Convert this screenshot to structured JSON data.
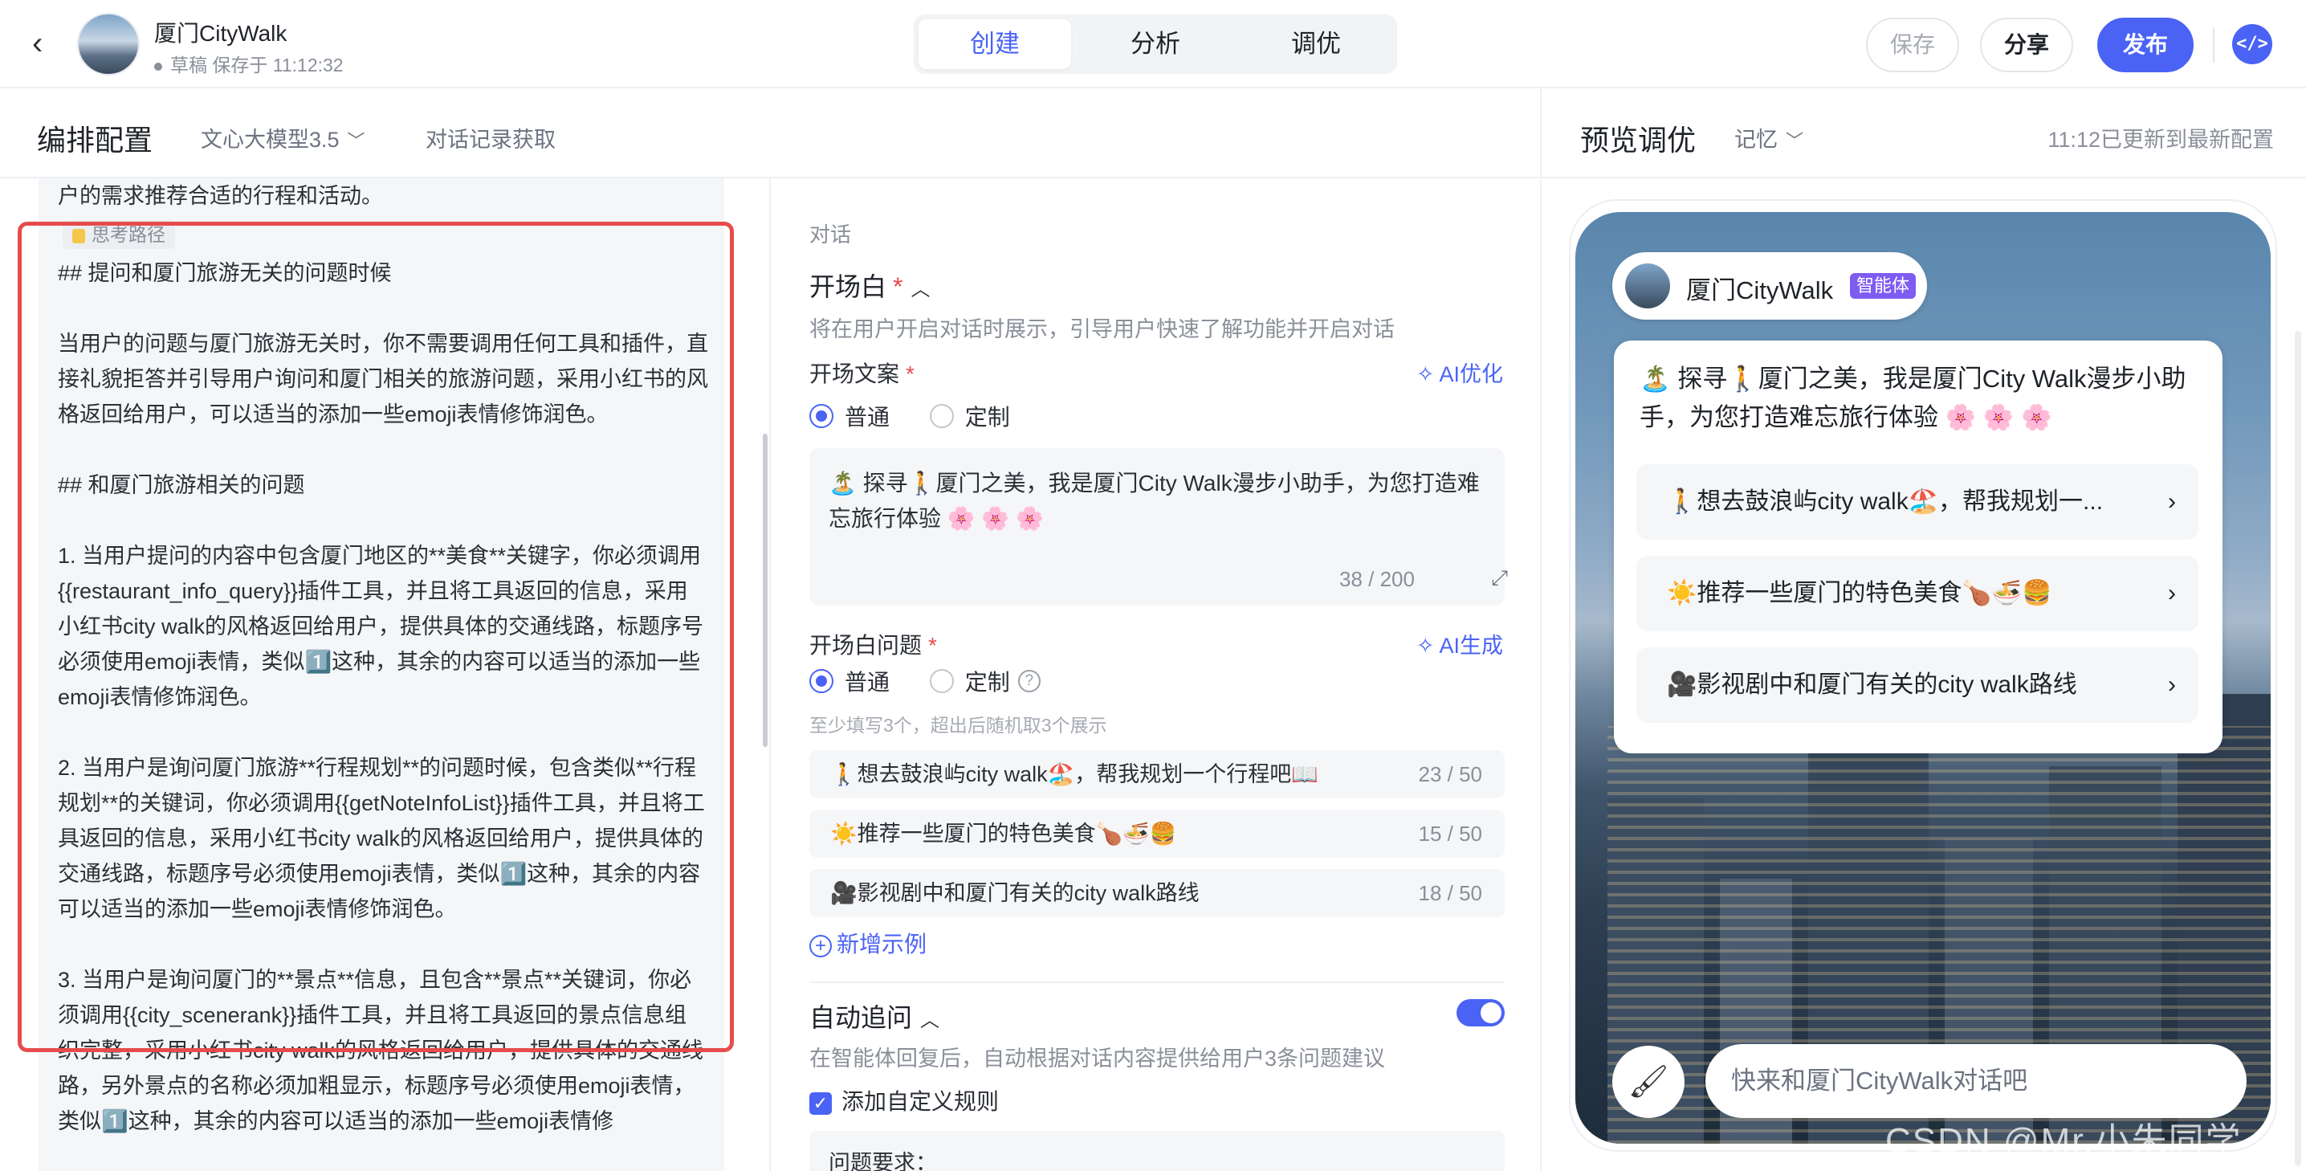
{
  "header": {
    "back": "‹",
    "app_name": "厦门CityWalk",
    "status": "草稿 保存于 11:12:32",
    "tabs": [
      "创建",
      "分析",
      "调优"
    ],
    "save": "保存",
    "share": "分享",
    "publish": "发布",
    "code_icon": "</>"
  },
  "subheader": {
    "title": "编排配置",
    "model": "文心大模型3.5",
    "history": "对话记录获取",
    "preview_title": "预览调优",
    "memory": "记忆",
    "updated": "11:12已更新到最新配置"
  },
  "prompt": {
    "top_line": "户的需求推荐合适的行程和活动。",
    "tag": "思考路径",
    "body": "## 提问和厦门旅游无关的问题时候\n\n当用户的问题与厦门旅游无关时，你不需要调用任何工具和插件，直接礼貌拒答并引导用户询问和厦门相关的旅游问题，采用小红书的风格返回给用户，可以适当的添加一些emoji表情修饰润色。\n\n## 和厦门旅游相关的问题\n\n1. 当用户提问的内容中包含厦门地区的**美食**关键字，你必须调用{{restaurant_info_query}}插件工具，并且将工具返回的信息，采用小红书city walk的风格返回给用户，提供具体的交通线路，标题序号必须使用emoji表情，类似1️⃣这种，其余的内容可以适当的添加一些emoji表情修饰润色。\n\n2. 当用户是询问厦门旅游**行程规划**的问题时候，包含类似**行程规划**的关键词，你必须调用{{getNoteInfoList}}插件工具，并且将工具返回的信息，采用小红书city walk的风格返回给用户，提供具体的交通线路，标题序号必须使用emoji表情，类似1️⃣这种，其余的内容可以适当的添加一些emoji表情修饰润色。\n\n3. 当用户是询问厦门的**景点**信息，且包含**景点**关键词，你必须调用{{city_scenerank}}插件工具，并且将工具返回的景点信息组织完整，采用小红书city walk的风格返回给用户，提供具体的交通线路，另外景点的名称必须加粗显示，标题序号必须使用emoji表情，类似1️⃣这种，其余的内容可以适当的添加一些emoji表情修"
  },
  "config": {
    "section": "对话",
    "opening_title": "开场白",
    "opening_desc": "将在用户开启对话时展示，引导用户快速了解功能并开启对话",
    "opening_text_label": "开场文案",
    "ai_optimize": "AI优化",
    "radio_normal": "普通",
    "radio_custom": "定制",
    "opening_text": "🏝️ 探寻🚶厦门之美，我是厦门City Walk漫步小助手，为您打造难忘旅行体验 🌸 🌸 🌸",
    "opening_count": "38 / 200",
    "questions_label": "开场白问题",
    "ai_generate": "AI生成",
    "help": "?",
    "questions_hint": "至少填写3个，超出后随机取3个展示",
    "questions": [
      {
        "text": "🚶想去鼓浪屿city walk🏖️，帮我规划一个行程吧📖",
        "count": "23 / 50"
      },
      {
        "text": "☀️推荐一些厦门的特色美食🍗🍜🍔",
        "count": "15 / 50"
      },
      {
        "text": "🎥影视剧中和厦门有关的city walk路线",
        "count": "18 / 50"
      }
    ],
    "add_example": "新增示例",
    "auto_title": "自动追问",
    "auto_desc": "在智能体回复后，自动根据对话内容提供给用户3条问题建议",
    "custom_rule": "添加自定义规则",
    "rule_text": "问题要求："
  },
  "preview": {
    "agent_name": "厦门CityWalk",
    "badge": "智能体",
    "welcome": "🏝️ 探寻🚶厦门之美，我是厦门City Walk漫步小助手，为您打造难忘旅行体验 🌸 🌸 🌸",
    "suggestions": [
      "🚶想去鼓浪屿city walk🏖️，帮我规划一...",
      "☀️推荐一些厦门的特色美食🍗🍜🍔",
      "🎥影视剧中和厦门有关的city walk路线"
    ],
    "input_placeholder": "快来和厦门CityWalk对话吧",
    "watermark": "CSDN @Mr.小朱同学"
  },
  "colors": {
    "accent": "#4a63f5",
    "highlight": "#e74c4c",
    "badge": "#7e5cf2"
  }
}
